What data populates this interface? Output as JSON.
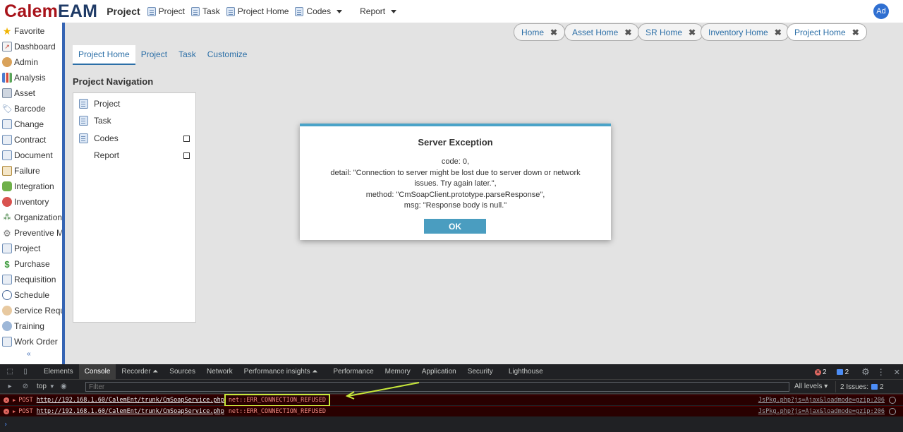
{
  "app": {
    "logo_a": "Calem",
    "logo_b": "EAM",
    "module": "Project",
    "avatar": "Ad"
  },
  "topnav": [
    {
      "label": "Project",
      "icon": "doc-icon"
    },
    {
      "label": "Task",
      "icon": "doc-icon"
    },
    {
      "label": "Project Home",
      "icon": "doc-icon"
    },
    {
      "label": "Codes",
      "icon": "doc-icon",
      "dropdown": true
    },
    {
      "label": "Report",
      "dropdown": true
    }
  ],
  "sidebar": {
    "items": [
      {
        "label": "Favorite",
        "icon": "star-icon"
      },
      {
        "label": "Dashboard",
        "icon": "dashboard-icon"
      },
      {
        "label": "Admin",
        "icon": "admin-icon"
      },
      {
        "label": "Analysis",
        "icon": "bar-chart-icon"
      },
      {
        "label": "Asset",
        "icon": "asset-icon"
      },
      {
        "label": "Barcode",
        "icon": "tag-icon"
      },
      {
        "label": "Change",
        "icon": "change-icon"
      },
      {
        "label": "Contract",
        "icon": "contract-icon"
      },
      {
        "label": "Document",
        "icon": "document-icon"
      },
      {
        "label": "Failure",
        "icon": "failure-icon"
      },
      {
        "label": "Integration",
        "icon": "puzzle-icon"
      },
      {
        "label": "Inventory",
        "icon": "inventory-icon"
      },
      {
        "label": "Organization",
        "icon": "org-icon"
      },
      {
        "label": "Preventive Ma",
        "icon": "gear-icon"
      },
      {
        "label": "Project",
        "icon": "project-icon"
      },
      {
        "label": "Purchase",
        "icon": "dollar-icon"
      },
      {
        "label": "Requisition",
        "icon": "requisition-icon"
      },
      {
        "label": "Schedule",
        "icon": "schedule-icon"
      },
      {
        "label": "Service Reque",
        "icon": "service-icon"
      },
      {
        "label": "Training",
        "icon": "training-icon"
      },
      {
        "label": "Work Order",
        "icon": "workorder-icon"
      }
    ],
    "collapse_glyph": "«"
  },
  "home_tabs": [
    {
      "label": "Home"
    },
    {
      "label": "Asset Home"
    },
    {
      "label": "SR Home"
    },
    {
      "label": "Inventory Home"
    },
    {
      "label": "Project Home",
      "active": true
    }
  ],
  "inner_tabs": [
    {
      "label": "Project Home",
      "active": true
    },
    {
      "label": "Project"
    },
    {
      "label": "Task"
    },
    {
      "label": "Customize"
    }
  ],
  "project_nav": {
    "heading": "Project Navigation",
    "items": [
      "Project",
      "Task",
      "Codes",
      "Report"
    ]
  },
  "dialog": {
    "title": "Server Exception",
    "lines": [
      "code: 0,",
      "detail: \"Connection to server might be lost due to server down or network issues. Try again later.\",",
      "method: \"CmSoapClient.prototype.parseResponse\",",
      "msg: \"Response body is null.\""
    ],
    "ok_label": "OK"
  },
  "devtools": {
    "tabs": [
      "Elements",
      "Console",
      "Recorder ⏶",
      "Sources",
      "Network",
      "Performance insights ⏶",
      "Performance",
      "Memory",
      "Application",
      "Security",
      "Lighthouse"
    ],
    "active_tab": "Console",
    "error_count": "2",
    "message_count": "2",
    "context": "top",
    "filter_placeholder": "Filter",
    "levels": "All levels ▾",
    "issues": "2 Issues:",
    "issues_count": "2",
    "logs": [
      {
        "method": "POST",
        "url": "http://192.168.1.60/CalemEnt/trunk/CmSoapService.php",
        "error": "net::ERR_CONNECTION_REFUSED",
        "source": "JsPkg.php?js=Ajax&loadmode=gzip:206"
      },
      {
        "method": "POST",
        "url": "http://192.168.1.60/CalemEnt/trunk/CmSoapService.php",
        "error": "net::ERR_CONNECTION_REFUSED",
        "source": "JsPkg.php?js=Ajax&loadmode=gzip:206"
      }
    ],
    "accent_highlight": "#c8e83a"
  }
}
